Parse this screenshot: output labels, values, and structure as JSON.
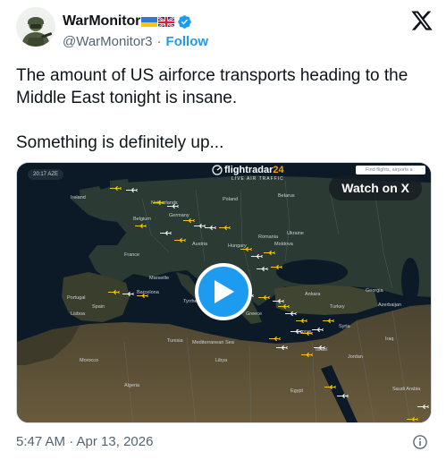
{
  "author": {
    "display_name": "WarMonitor",
    "flags": [
      "ukraine-flag",
      "uk-flag"
    ],
    "verified_icon": "verified-badge-icon",
    "handle": "@WarMonitor3",
    "separator": "·",
    "follow_label": "Follow"
  },
  "tweet": {
    "line1": "The amount of US airforce transports heading to the Middle East tonight is insane.",
    "line2": "Something is definitely up..."
  },
  "media": {
    "watch_label": "Watch on X",
    "brand_prefix": "flightradar",
    "brand_number": "24",
    "brand_sub": "LIVE AIR TRAFFIC",
    "search_placeholder": "Find flights, airports a",
    "time_pill": "20:17 AZE",
    "map_labels": [
      "Ireland",
      "Netherlands",
      "Belgium",
      "Germany",
      "Poland",
      "Belarus",
      "France",
      "Austria",
      "Hungary",
      "Romania",
      "Moldova",
      "Ukraine",
      "Marseille",
      "Barcelona",
      "Portugal",
      "Spain",
      "Lisboa",
      "Tunisia",
      "Algeria",
      "Morocco",
      "Libya",
      "Egypt",
      "Georgia",
      "Azerbaijan",
      "Iraq",
      "Jordan",
      "Saudi Arabia",
      "Mediterranean Sea",
      "Tyrrhenian",
      "Turkey",
      "Greece",
      "Cyprus",
      "Syria",
      "Israel",
      "Ankara"
    ]
  },
  "footer": {
    "timestamp": "5:47 AM · Apr 13, 2026"
  },
  "colors": {
    "accent": "#1d9bf0",
    "text": "#0f1419",
    "muted": "#536471",
    "map_sea": "#0c1a28",
    "map_land": "#2b3a32",
    "plane": "#f2c21b"
  }
}
